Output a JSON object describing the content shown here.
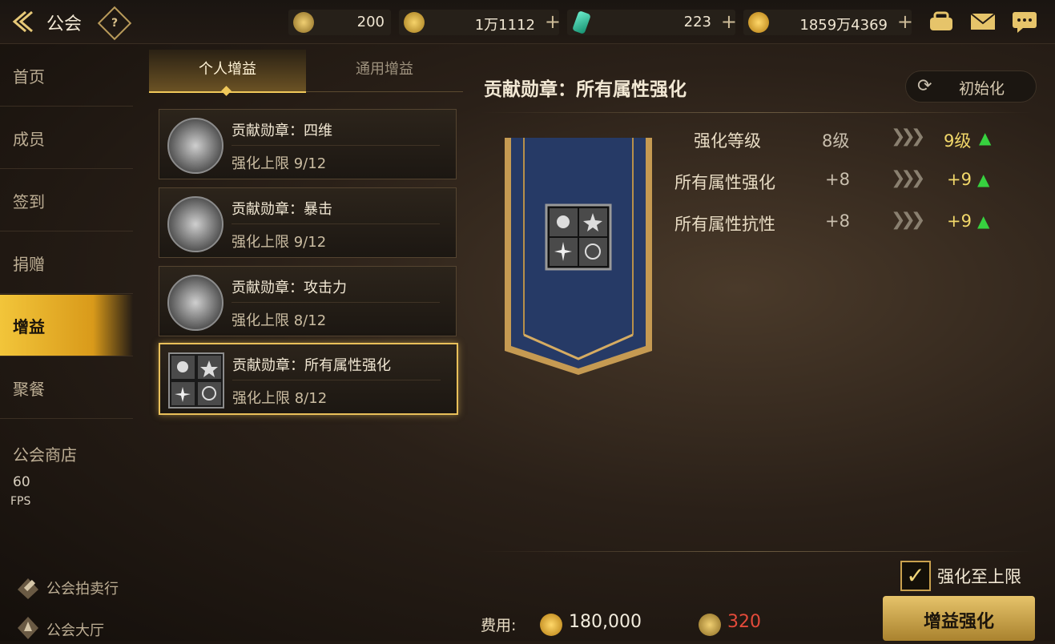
{
  "header": {
    "title": "公会",
    "help_icon": "?"
  },
  "currencies": [
    {
      "name": "medal",
      "value": "200",
      "icon_color": "#caa24a"
    },
    {
      "name": "c-coin",
      "value": "1万1112",
      "icon_color": "#d9a935"
    },
    {
      "name": "gem",
      "value": "223",
      "icon_color": "#2fc7a0"
    },
    {
      "name": "gold",
      "value": "1859万4369",
      "icon_color": "#e0a628"
    }
  ],
  "sidebar": {
    "items": [
      {
        "label": "首页"
      },
      {
        "label": "成员"
      },
      {
        "label": "签到"
      },
      {
        "label": "捐赠"
      },
      {
        "label": "增益",
        "active": true
      },
      {
        "label": "聚餐"
      }
    ],
    "shop": "公会商店",
    "auction": "公会拍卖行",
    "hall": "公会大厅",
    "fps_value": "60",
    "fps_label": "FPS"
  },
  "tabs": {
    "personal": "个人增益",
    "general": "通用增益"
  },
  "buffs": [
    {
      "name": "贡献勋章：四维",
      "limit": "强化上限 9/12"
    },
    {
      "name": "贡献勋章：暴击",
      "limit": "强化上限 9/12"
    },
    {
      "name": "贡献勋章：攻击力",
      "limit": "强化上限 8/12"
    },
    {
      "name": "贡献勋章：所有属性强化",
      "limit": "强化上限 8/12",
      "selected": true
    }
  ],
  "detail": {
    "title": "贡献勋章：所有属性强化",
    "reset": "初始化",
    "stats": [
      {
        "label": "强化等级",
        "cur": "8级",
        "next": "9级"
      },
      {
        "label": "所有属性强化",
        "cur": "+8",
        "next": "+9"
      },
      {
        "label": "所有属性抗性",
        "cur": "+8",
        "next": "+9"
      }
    ]
  },
  "footer": {
    "max_label": "强化至上限",
    "cost_label": "费用:",
    "gold_cost": "180,000",
    "medal_cost": "320",
    "enhance_button": "增益强化"
  }
}
